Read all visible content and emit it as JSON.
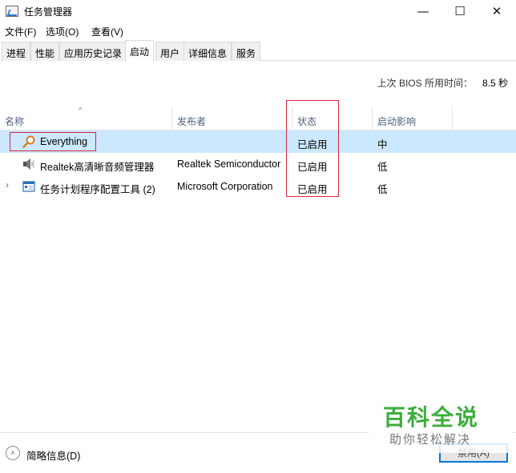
{
  "window": {
    "title": "任务管理器",
    "minimize_glyph": "—",
    "maximize_glyph": "☐",
    "close_glyph": "✕"
  },
  "menu": [
    "文件(F)",
    "选项(O)",
    "查看(V)"
  ],
  "tabs": [
    "进程",
    "性能",
    "应用历史记录",
    "启动",
    "用户",
    "详细信息",
    "服务"
  ],
  "active_tab": "启动",
  "bios": {
    "label": "上次 BIOS 所用时间：",
    "value": "8.5 秒"
  },
  "table": {
    "headers": {
      "name": "名称",
      "publisher": "发布者",
      "status": "状态",
      "impact": "启动影响"
    },
    "rows": [
      {
        "name": "Everything",
        "publisher": "",
        "status": "已启用",
        "impact": "中",
        "icon": "magnifier-icon",
        "selected": true,
        "expandable": false
      },
      {
        "name": "Realtek高清晰音频管理器",
        "publisher": "Realtek Semiconductor",
        "status": "已启用",
        "impact": "低",
        "icon": "speaker-icon",
        "selected": false,
        "expandable": false
      },
      {
        "name": "任务计划程序配置工具 (2)",
        "publisher": "Microsoft Corporation",
        "status": "已启用",
        "impact": "低",
        "icon": "task-scheduler-icon",
        "selected": false,
        "expandable": true
      }
    ]
  },
  "footer": {
    "brief_label": "简略信息(D)",
    "disable_label": "禁用(A)"
  },
  "watermark": {
    "title": "百科全说",
    "subtitle": "助你轻松解决"
  },
  "colors": {
    "selection": "#cce8ff",
    "highlight_box": "#d7263d",
    "header_text": "#4d6082",
    "watermark_green": "#3cae3c"
  }
}
